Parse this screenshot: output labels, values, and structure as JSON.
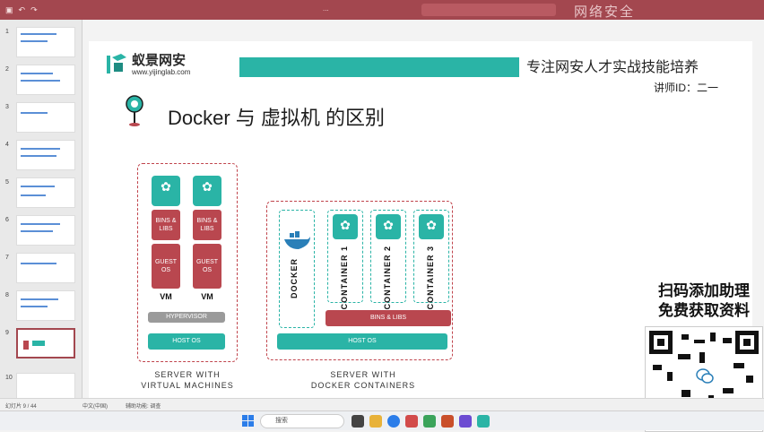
{
  "titlebar": {
    "doc_title": "...",
    "watermark": "网络安全"
  },
  "slide": {
    "brand_name": "蚁景网安",
    "brand_url": "www.yijinglab.com",
    "slogan": "专注网安人才实战技能培养",
    "lecturer": "讲师ID：二一",
    "title": "Docker 与 虚拟机 的区别"
  },
  "vm_diagram": {
    "bins_libs_label": "BINS & LIBS",
    "guest_os_label": "GUEST OS",
    "vm_label": "VM",
    "hypervisor_label": "HYPERVISOR",
    "host_os_label": "HOST OS",
    "caption_line1": "SERVER WITH",
    "caption_line2": "VIRTUAL MACHINES"
  },
  "docker_diagram": {
    "docker_label": "DOCKER",
    "containers": [
      "CONTAINER 1",
      "CONTAINER 2",
      "CONTAINER 3"
    ],
    "bins_libs_label": "BINS & LIBS",
    "host_os_label": "HOST OS",
    "caption_line1": "SERVER WITH",
    "caption_line2": "DOCKER CONTAINERS"
  },
  "promo": {
    "line1": "扫码添加助理",
    "line2": "免费获取资料"
  },
  "sidebar": {
    "slide_numbers": [
      "1",
      "2",
      "3",
      "4",
      "5",
      "6",
      "7",
      "8",
      "9",
      "10"
    ],
    "active_slide": "9"
  },
  "statusbar": {
    "left": "幻灯片 9 / 44",
    "lang": "中文(中国)",
    "access": "辅助功能: 调查"
  },
  "taskbar": {
    "search_placeholder": "搜索"
  },
  "colors": {
    "teal": "#2ab4a6",
    "red": "#b9474f",
    "titlebar": "#a3474f"
  }
}
